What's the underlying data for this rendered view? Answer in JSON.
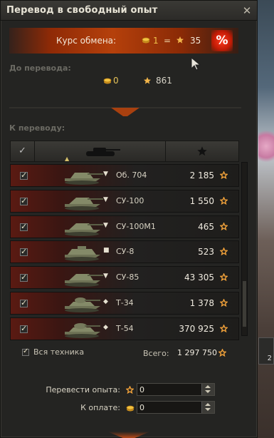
{
  "window": {
    "title": "Перевод в свободный опыт",
    "close_icon": "close-icon"
  },
  "rate": {
    "label": "Курс обмена:",
    "gold": "1",
    "equals": "=",
    "xp": "35",
    "percent_button": "%"
  },
  "before": {
    "label": "До перевода:",
    "gold": "0",
    "xp": "861"
  },
  "to_convert": {
    "label": "К переводу:"
  },
  "table": {
    "header_check": "✓",
    "rows": [
      {
        "tier": "▼",
        "name": "Об. 704",
        "xp": "2 185"
      },
      {
        "tier": "▼",
        "name": "СУ-100",
        "xp": "1 550"
      },
      {
        "tier": "▼",
        "name": "СУ-100М1",
        "xp": "465"
      },
      {
        "tier": "■",
        "name": "СУ-8",
        "xp": "523"
      },
      {
        "tier": "▼",
        "name": "СУ-85",
        "xp": "43 305"
      },
      {
        "tier": "◆",
        "name": "Т-34",
        "xp": "1 378"
      },
      {
        "tier": "◆",
        "name": "Т-54",
        "xp": "370 925"
      }
    ]
  },
  "footer": {
    "all_vehicles_label": "Вся техника",
    "total_label": "Всего:",
    "total_value": "1 297 750"
  },
  "form": {
    "convert_label": "Перевести опыта:",
    "convert_value": "0",
    "pay_label": "К оплате:",
    "pay_value": "0"
  },
  "side": {
    "badge": "2"
  },
  "colors": {
    "accent_orange": "#b5400b",
    "gold": "#f0c24a",
    "xp_star": "#f2a23a"
  }
}
